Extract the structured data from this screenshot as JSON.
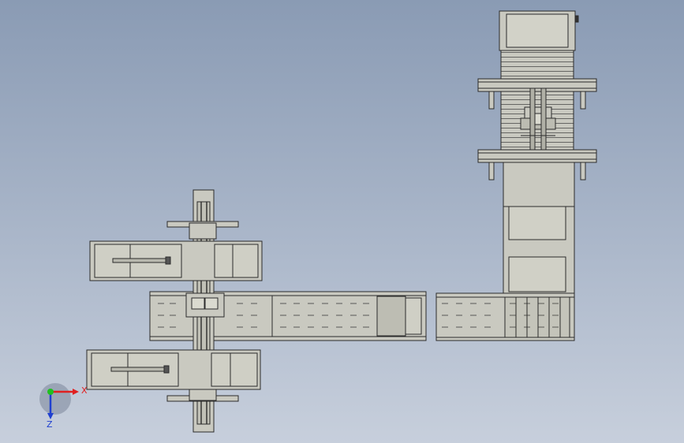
{
  "viewport": {
    "background_top": "#8a9bb4",
    "background_bottom": "#c7cfdc",
    "part_fill": "#c9c9c0",
    "part_stroke": "#2b2b2b"
  },
  "triad": {
    "x_label": "X",
    "z_label": "Z",
    "x_color": "#e02020",
    "y_color": "#20c020",
    "z_color": "#2040d0"
  }
}
